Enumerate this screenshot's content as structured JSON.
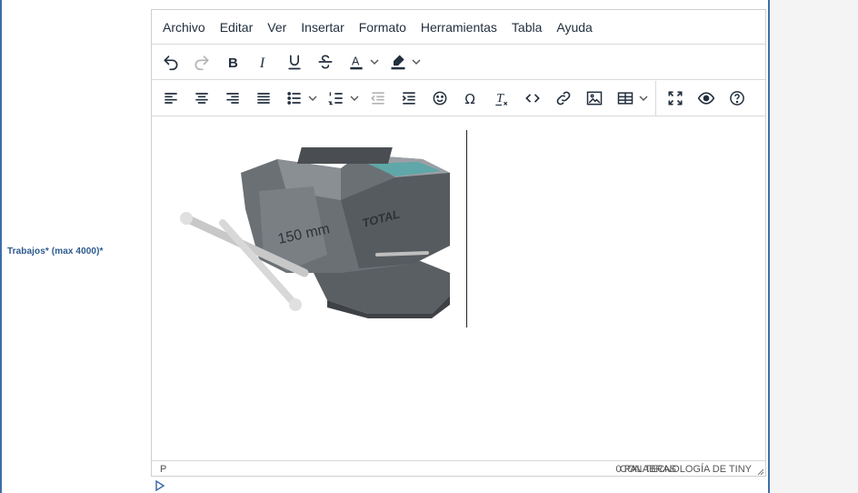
{
  "field": {
    "label": "Trabajos* (max 4000)*"
  },
  "menubar": {
    "items": [
      "Archivo",
      "Editar",
      "Ver",
      "Insertar",
      "Formato",
      "Herramientas",
      "Tabla",
      "Ayuda"
    ]
  },
  "toolbar1": {
    "buttons": [
      "undo-icon",
      "redo-icon",
      "bold-icon",
      "italic-icon",
      "underline-icon",
      "strikethrough-icon",
      "text-color-icon",
      "highlight-color-icon"
    ],
    "text_color": "#222f3e",
    "highlight_color": "#222f3e"
  },
  "toolbar2": {
    "buttons": [
      "align-left-icon",
      "align-center-icon",
      "align-right-icon",
      "align-justify-icon",
      "bullet-list-icon",
      "numbered-list-icon",
      "outdent-icon",
      "indent-icon",
      "emoji-icon",
      "special-char-icon",
      "clear-format-icon",
      "code-icon",
      "link-icon",
      "image-icon",
      "table-icon",
      "fullscreen-icon",
      "preview-icon",
      "help-icon"
    ]
  },
  "content": {
    "image_text": "150 mm",
    "brand_text": "TOTAL"
  },
  "statusbar": {
    "path": "P",
    "word_count": "0 PALABRAS",
    "branding": "CON TECNOLOGÍA DE TINY"
  }
}
